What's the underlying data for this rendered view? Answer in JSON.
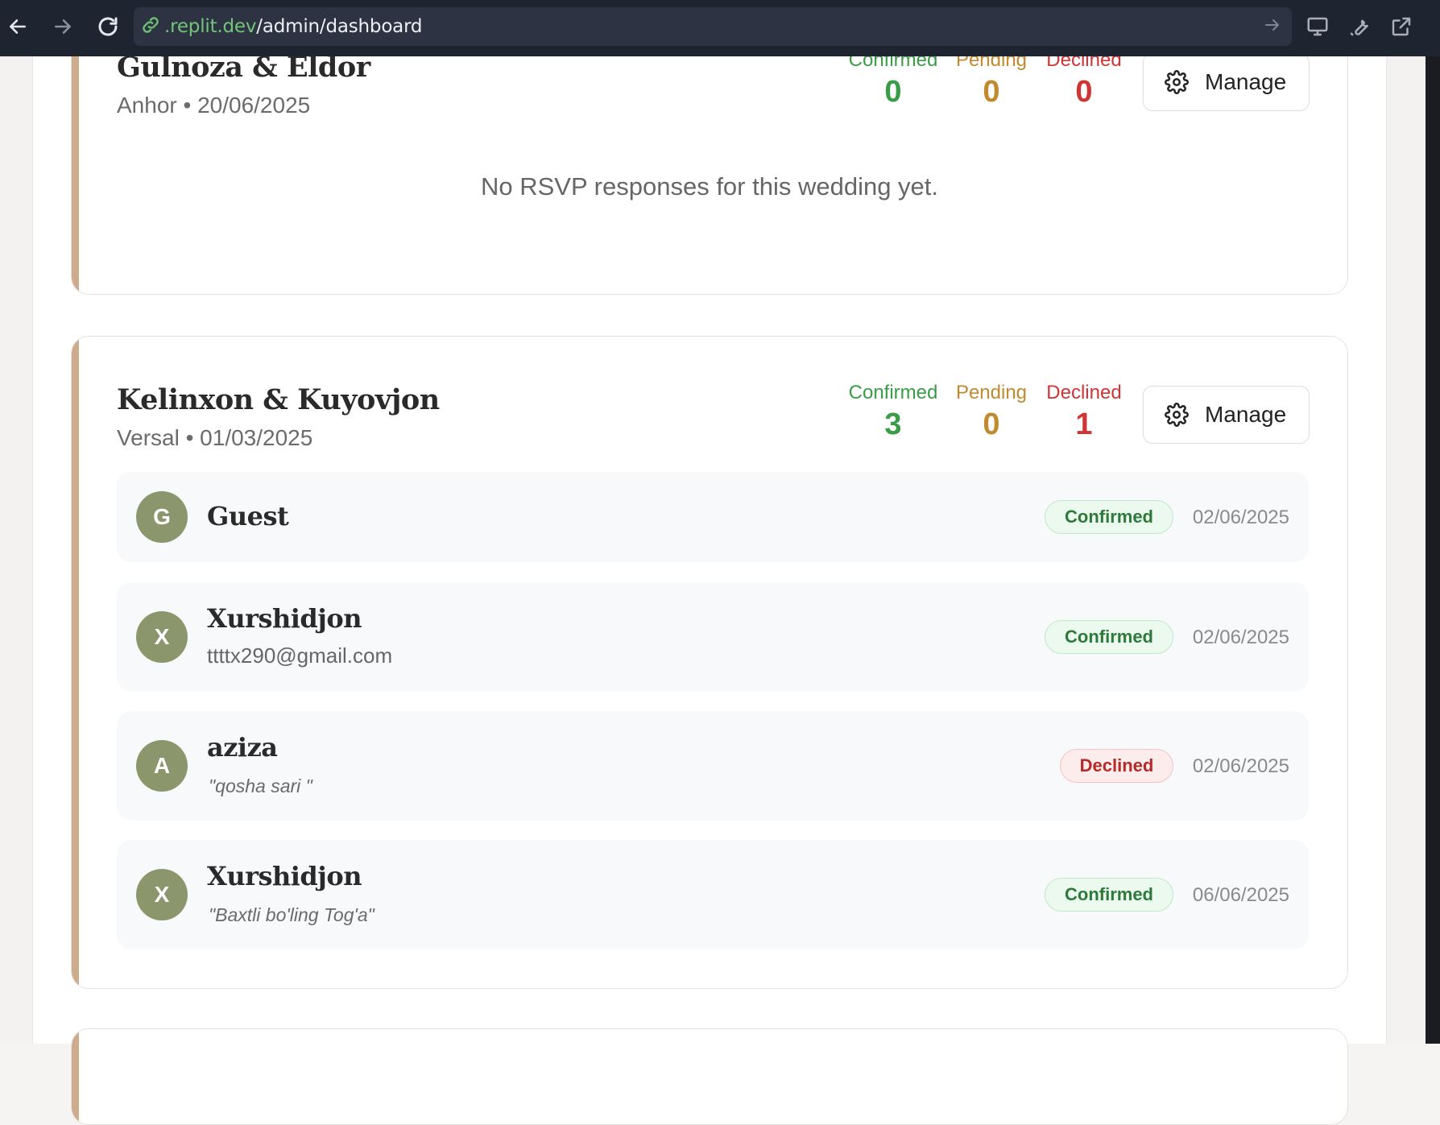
{
  "browser": {
    "url_host": ".replit.dev",
    "url_path": "/admin/dashboard"
  },
  "weddings": [
    {
      "couple": "Gulnoza & Eldor",
      "venue_date": "Anhor • 20/06/2025",
      "stats": {
        "confirmed_label": "Confirmed",
        "confirmed": "0",
        "pending_label": "Pending",
        "pending": "0",
        "declined_label": "Declined",
        "declined": "0"
      },
      "manage_label": "Manage",
      "empty_message": "No RSVP responses for this wedding yet."
    },
    {
      "couple": "Kelinxon & Kuyovjon",
      "venue_date": "Versal • 01/03/2025",
      "stats": {
        "confirmed_label": "Confirmed",
        "confirmed": "3",
        "pending_label": "Pending",
        "pending": "0",
        "declined_label": "Declined",
        "declined": "1"
      },
      "manage_label": "Manage",
      "responses": [
        {
          "initial": "G",
          "name": "Guest",
          "status": "Confirmed",
          "date": "02/06/2025"
        },
        {
          "initial": "X",
          "name": "Xurshidjon",
          "email": "ttttx290@gmail.com",
          "status": "Confirmed",
          "date": "02/06/2025"
        },
        {
          "initial": "A",
          "name": "aziza",
          "note": "\"qosha sari \"",
          "status": "Declined",
          "date": "02/06/2025"
        },
        {
          "initial": "X",
          "name": "Xurshidjon",
          "note": "\"Baxtli bo'ling Tog'a\"",
          "status": "Confirmed",
          "date": "06/06/2025"
        }
      ]
    }
  ],
  "colors": {
    "confirmed": "#3a9c47",
    "pending": "#c18a2e",
    "declined": "#cf3535",
    "accent_border": "#cfab8d",
    "avatar_bg": "#8b966d"
  }
}
